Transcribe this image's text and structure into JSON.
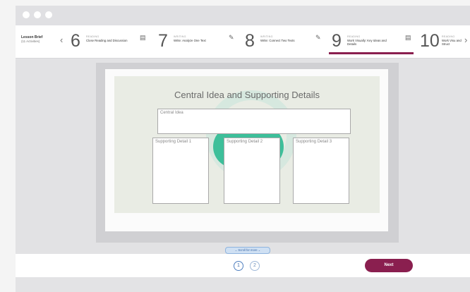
{
  "lesson": {
    "brief_title": "Lesson Brief",
    "brief_count": "(11 Activities)"
  },
  "activities": [
    {
      "number": "6",
      "category": "Reading",
      "title": "Close Reading and Discussion",
      "icon": "book-icon"
    },
    {
      "number": "7",
      "category": "Writing",
      "title": "Write: Analyze One Text",
      "icon": "pencil-icon"
    },
    {
      "number": "8",
      "category": "Writing",
      "title": "Write: Connect Two Texts",
      "icon": "pencil-icon"
    },
    {
      "number": "9",
      "category": "Reading",
      "title": "Work Visually: Key Ideas and Details",
      "icon": "book-icon",
      "active": true
    },
    {
      "number": "10",
      "category": "Reading",
      "title": "Work Visu and Struct",
      "icon": "book-icon"
    }
  ],
  "slide": {
    "title": "Central Idea and Supporting Details",
    "central_label": "Central Idea",
    "details": [
      "Supporting Detail 1",
      "Supporting Detail 2",
      "Supporting Detail 3"
    ]
  },
  "scroll_hint": "⌄ Scroll for more ⌄",
  "pager": [
    "1",
    "2"
  ],
  "next_label": "Next",
  "colors": {
    "accent": "#8a1f4f",
    "teal": "#3dbf9a",
    "link": "#3d6aa8"
  }
}
